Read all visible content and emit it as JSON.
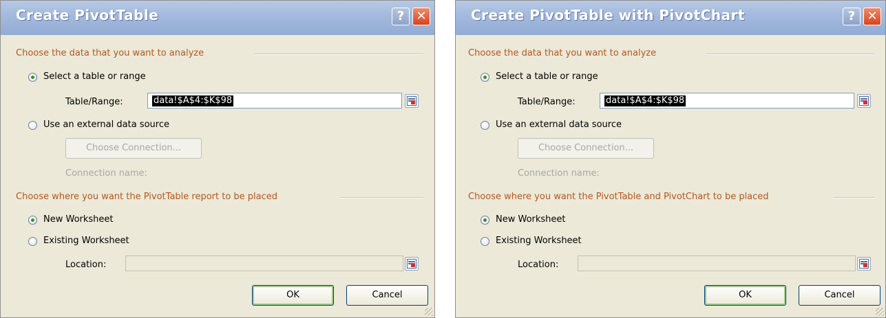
{
  "dialogs": [
    {
      "title": "Create PivotTable",
      "help_glyph": "?",
      "close_glyph": "✕",
      "section1": "Choose the data that you want to analyze",
      "radio_range": "Select a table or range",
      "table_range_label": "Table/Range:",
      "table_range_value": "data!$A$4:$K$98",
      "radio_external": "Use an external data source",
      "choose_connection": "Choose Connection...",
      "connection_name": "Connection name:",
      "section2": "Choose where you want the PivotTable report to be placed",
      "radio_new": "New Worksheet",
      "radio_existing": "Existing Worksheet",
      "location_label": "Location:",
      "location_value": "",
      "ok": "OK",
      "cancel": "Cancel"
    },
    {
      "title": "Create PivotTable with PivotChart",
      "help_glyph": "?",
      "close_glyph": "✕",
      "section1": "Choose the data that you want to analyze",
      "radio_range": "Select a table or range",
      "table_range_label": "Table/Range:",
      "table_range_value": "data!$A$4:$K$98",
      "radio_external": "Use an external data source",
      "choose_connection": "Choose Connection...",
      "connection_name": "Connection name:",
      "section2": "Choose where you want the PivotTable and PivotChart to be placed",
      "radio_new": "New Worksheet",
      "radio_existing": "Existing Worksheet",
      "location_label": "Location:",
      "location_value": "",
      "ok": "OK",
      "cancel": "Cancel"
    }
  ],
  "colors": {
    "section_text": "#b8561e",
    "titlebar": "#a3b9dd",
    "dialog_bg": "#ece9d8",
    "radio_dot": "#3f8d2a"
  },
  "icons": {
    "range_picker": "collapse-dialog-icon"
  }
}
